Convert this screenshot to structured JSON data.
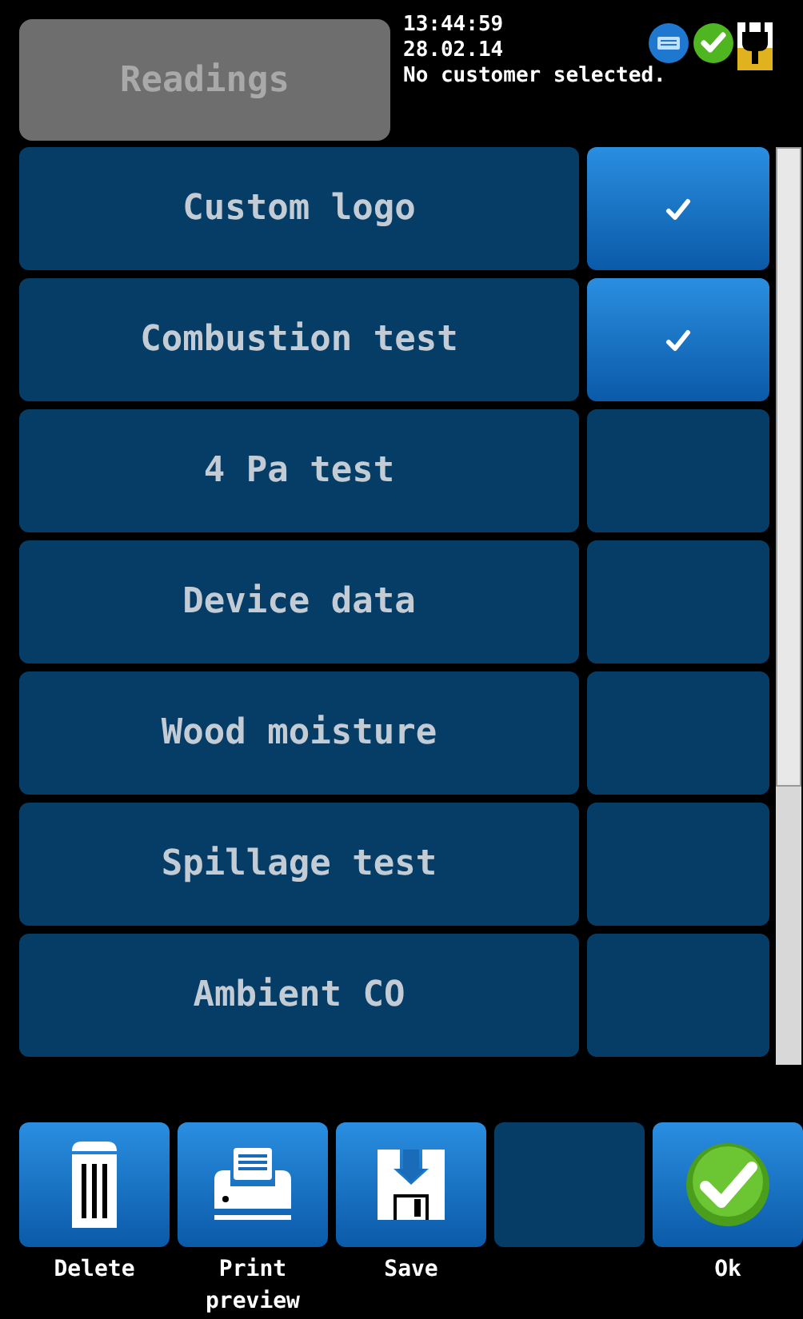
{
  "header": {
    "title_button": "Readings",
    "time": "13:44:59",
    "date": "28.02.14",
    "customer_status": "No customer selected."
  },
  "items": [
    {
      "label": "Custom logo",
      "checked": true
    },
    {
      "label": "Combustion test",
      "checked": true
    },
    {
      "label": "4 Pa test",
      "checked": false
    },
    {
      "label": "Device data",
      "checked": false
    },
    {
      "label": "Wood moisture",
      "checked": false
    },
    {
      "label": "Spillage test",
      "checked": false
    },
    {
      "label": "Ambient CO",
      "checked": false
    }
  ],
  "toolbar": [
    {
      "kind": "delete",
      "label": "Delete"
    },
    {
      "kind": "print",
      "label": "Print preview"
    },
    {
      "kind": "save",
      "label": "Save"
    },
    {
      "kind": "empty"
    },
    {
      "kind": "ok",
      "label": "Ok"
    }
  ]
}
